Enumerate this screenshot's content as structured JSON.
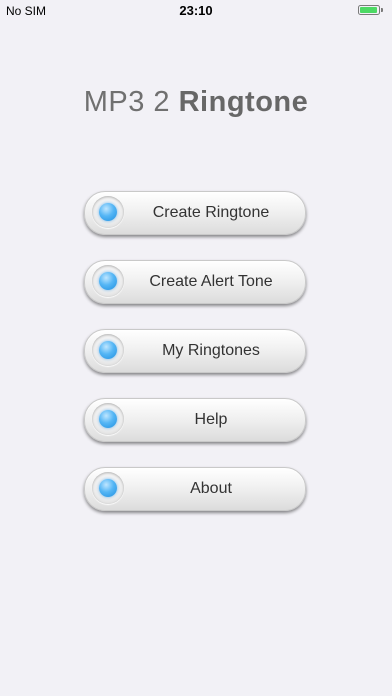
{
  "status_bar": {
    "carrier": "No SIM",
    "time": "23:10",
    "battery_level": 0.95,
    "battery_color": "#4cd964"
  },
  "app": {
    "title_light": "MP3 2",
    "title_bold": "Ringtone"
  },
  "menu": {
    "items": [
      {
        "label": "Create Ringtone",
        "icon": "blue-led-icon"
      },
      {
        "label": "Create Alert Tone",
        "icon": "blue-led-icon"
      },
      {
        "label": "My Ringtones",
        "icon": "blue-led-icon"
      },
      {
        "label": "Help",
        "icon": "blue-led-icon"
      },
      {
        "label": "About",
        "icon": "blue-led-icon"
      }
    ]
  },
  "colors": {
    "background": "#f2f1f6",
    "led_accent": "#2f9ae8"
  }
}
